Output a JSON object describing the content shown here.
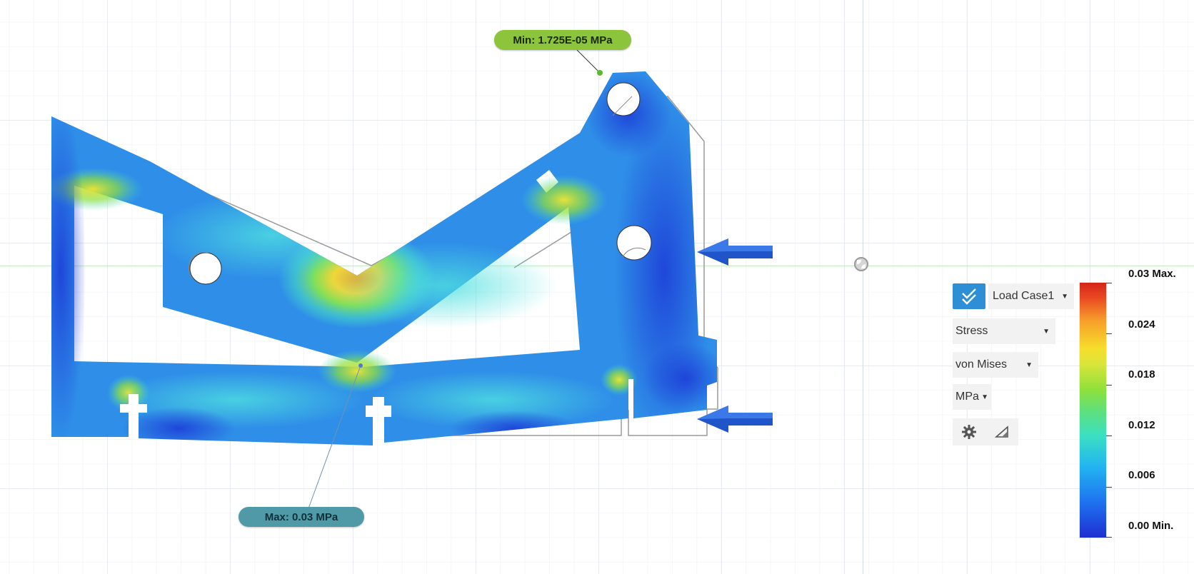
{
  "callouts": {
    "min": "Min: 1.725E-05 MPa",
    "max": "Max: 0.03 MPa"
  },
  "panel": {
    "load_case": "Load Case1",
    "result_type": "Stress",
    "criterion": "von Mises",
    "units": "MPa",
    "icons": [
      "checkmark-icon",
      "gear-icon",
      "probe-icon"
    ]
  },
  "legend": {
    "labels": [
      "0.03 Max.",
      "0.024",
      "0.018",
      "0.012",
      "0.006",
      "0.00 Min."
    ],
    "colors": [
      "#1f2fd1",
      "#22b5f0",
      "#5fe07a",
      "#f6de2c",
      "#d42418"
    ]
  },
  "colors": {
    "load_arrow": "#1f55c8",
    "min_callout": "#8cc43c",
    "max_callout": "#4f9aa6",
    "accent": "#2e8fd6"
  }
}
